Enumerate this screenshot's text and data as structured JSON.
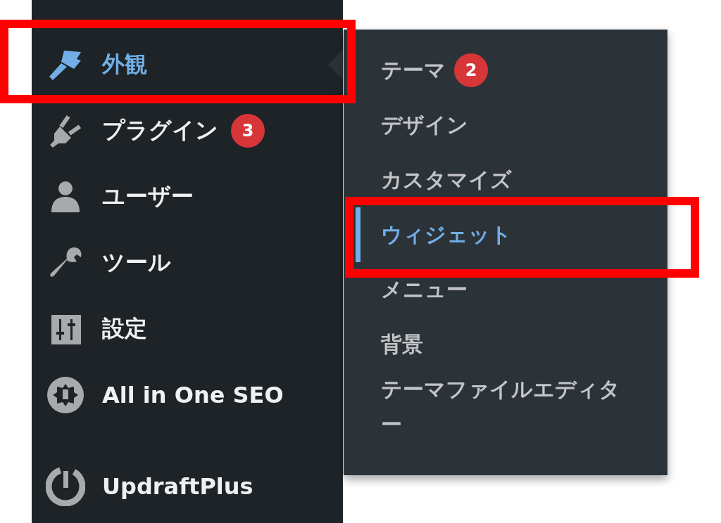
{
  "sidebar": {
    "items": [
      {
        "label": "外観",
        "current": true,
        "highlighted": true
      },
      {
        "label": "プラグイン",
        "current": false,
        "highlighted": false,
        "badge": "3"
      },
      {
        "label": "ユーザー",
        "current": false,
        "highlighted": false
      },
      {
        "label": "ツール",
        "current": false,
        "highlighted": false
      },
      {
        "label": "設定",
        "current": false,
        "highlighted": false
      },
      {
        "label": "All in One SEO",
        "current": false,
        "highlighted": false
      },
      {
        "label": "UpdraftPlus",
        "current": false,
        "highlighted": false
      }
    ]
  },
  "submenu": {
    "items": [
      {
        "label": "テーマ",
        "selected": false,
        "highlighted": false,
        "badge": "2"
      },
      {
        "label": "デザイン",
        "selected": false,
        "highlighted": false
      },
      {
        "label": "カスタマイズ",
        "selected": false,
        "highlighted": false
      },
      {
        "label": "ウィジェット",
        "selected": true,
        "highlighted": true
      },
      {
        "label": "メニュー",
        "selected": false,
        "highlighted": false
      },
      {
        "label": "背景",
        "selected": false,
        "highlighted": false
      },
      {
        "label": "テーマファイルエディター",
        "selected": false,
        "highlighted": false
      }
    ]
  }
}
